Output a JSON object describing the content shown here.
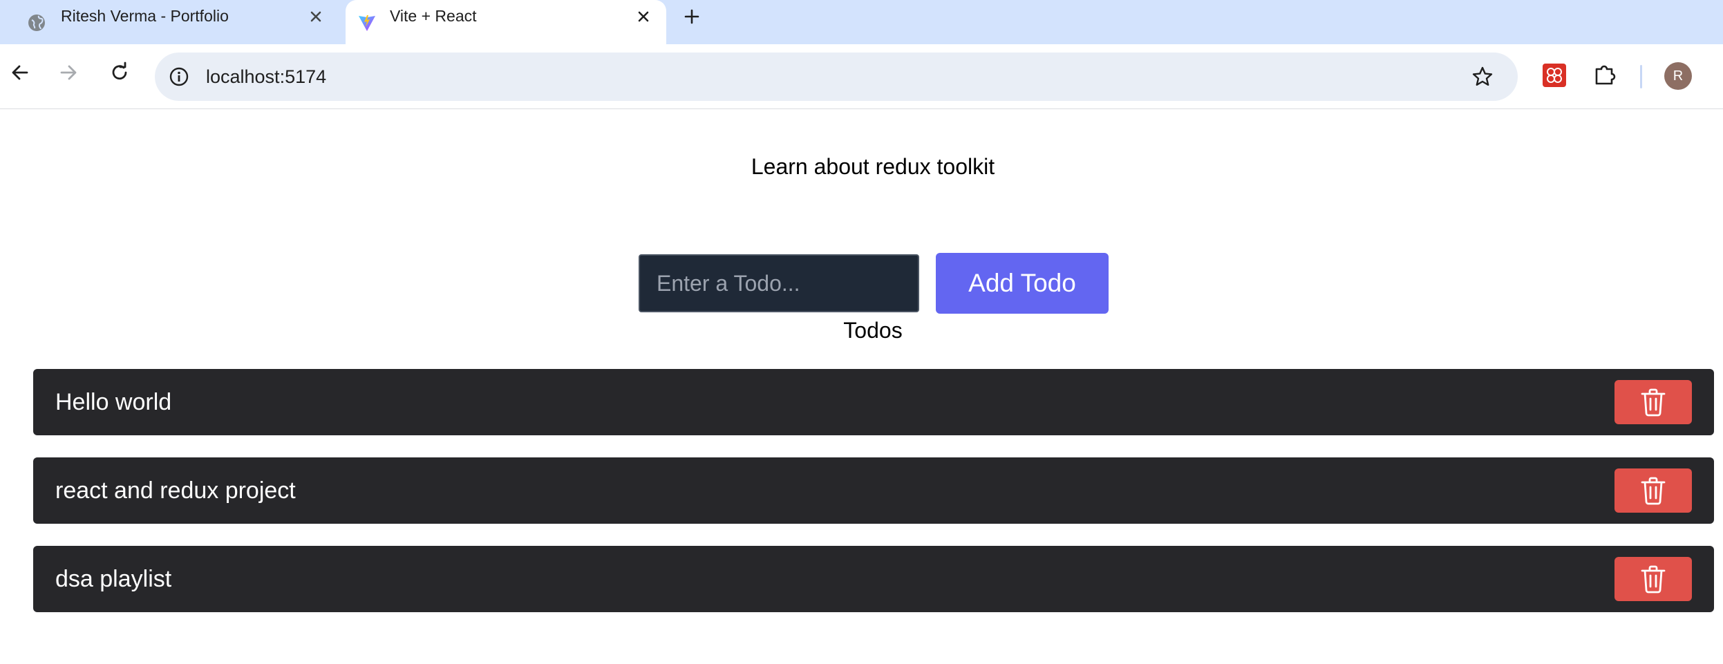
{
  "browser": {
    "tabs": [
      {
        "title": "Ritesh Verma - Portfolio",
        "active": false,
        "favicon": "globe-icon"
      },
      {
        "title": "Vite + React",
        "active": true,
        "favicon": "vite-logo-icon"
      }
    ],
    "address": "localhost:5174",
    "profile_initial": "R"
  },
  "page": {
    "heading": "Learn about redux toolkit",
    "input": {
      "placeholder": "Enter a Todo...",
      "value": ""
    },
    "add_button_label": "Add Todo",
    "todos_heading": "Todos",
    "todos": [
      {
        "text": "Hello world"
      },
      {
        "text": "react and redux project"
      },
      {
        "text": "dsa playlist"
      }
    ]
  },
  "colors": {
    "tabstrip": "#d3e3fd",
    "input_bg": "#1f2937",
    "add_button": "#6366f1",
    "todo_row": "#27272a",
    "delete_button": "#e0514a"
  }
}
